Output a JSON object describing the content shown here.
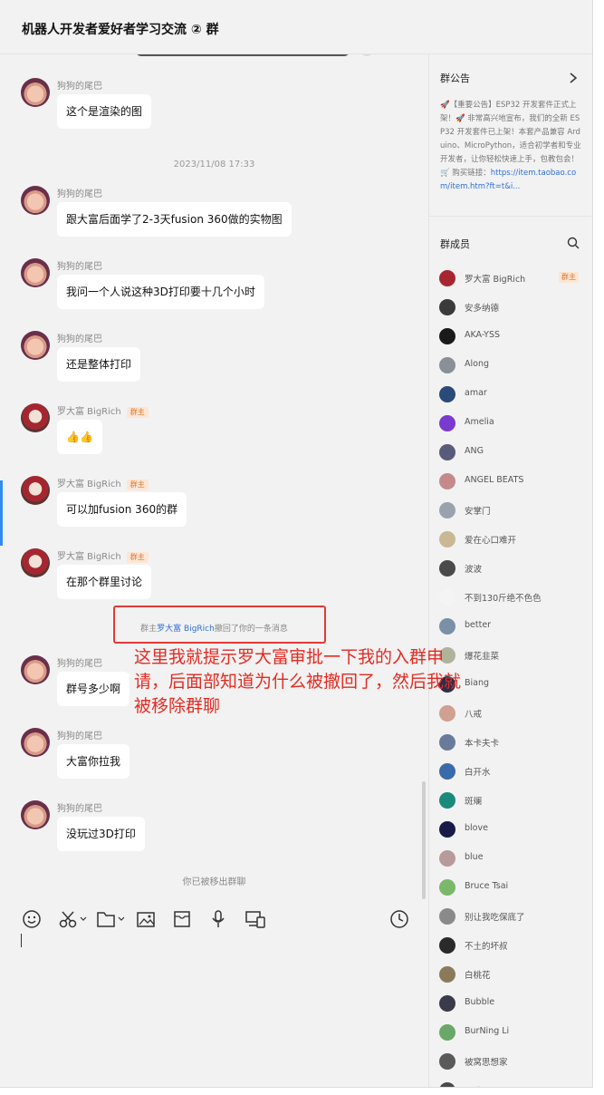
{
  "window": {
    "title": "机器人开发者爱好者学习交流 ② 群"
  },
  "chat": {
    "messages": [
      {
        "sender": "狗狗的尾巴",
        "text": "这个是渲染的图"
      },
      {
        "sender": "狗狗的尾巴",
        "text": "跟大富后面学了2-3天fusion 360做的实物图"
      },
      {
        "sender": "狗狗的尾巴",
        "text": "我问一个人说这种3D打印要十几个小时"
      },
      {
        "sender": "狗狗的尾巴",
        "text": "还是整体打印"
      },
      {
        "sender": "罗大富 BigRich",
        "badge": "群主",
        "text": "👍👍"
      },
      {
        "sender": "罗大富 BigRich",
        "badge": "群主",
        "text": "可以加fusion 360的群"
      },
      {
        "sender": "罗大富 BigRich",
        "badge": "群主",
        "text": "在那个群里讨论"
      },
      {
        "sender": "狗狗的尾巴",
        "text": "群号多少啊"
      },
      {
        "sender": "狗狗的尾巴",
        "text": "大富你拉我"
      },
      {
        "sender": "狗狗的尾巴",
        "text": "没玩过3D打印"
      }
    ],
    "timestamp": "2023/11/08 17:33",
    "recall_note": {
      "prefix": "群主",
      "name": "罗大富 BigRich",
      "suffix": "撤回了你的一条消息"
    },
    "removed_note": "你已被移出群聊",
    "annotation": "这里我就提示罗大富审批一下我的入群申请，后面部知道为什么被撤回了，然后我就被移除群聊"
  },
  "toolbar": {
    "icons": [
      "emoji-icon",
      "scissors-icon",
      "folder-icon",
      "image-icon",
      "inbox-icon",
      "microphone-icon",
      "screen-share-icon",
      "history-clock-icon"
    ]
  },
  "panel": {
    "notice_title": "群公告",
    "notice_text": "🚀【重要公告】ESP32 开发套件正式上架！🚀 非常高兴地宣布，我们的全新 ESP32 开发套件已上架！本套产品兼容 Arduino、MicroPython，适合初学者和专业开发者，让你轻松快速上手，包教包会！🛒 购买链接：",
    "notice_url": "https://item.taobao.com/item.htm?ft=t&i...",
    "members_title": "群成员",
    "members": [
      {
        "name": "罗大富 BigRich",
        "badge": "群主",
        "color": "#a52630"
      },
      {
        "name": "安多纳德",
        "color": "#3a3a3a"
      },
      {
        "name": "AKA-YSS",
        "color": "#1a1a1a"
      },
      {
        "name": "Along",
        "color": "#8a8f98"
      },
      {
        "name": "amar",
        "color": "#2a4a7a"
      },
      {
        "name": "Amelia",
        "color": "#7a3ad0"
      },
      {
        "name": "ANG",
        "color": "#5a5a7a"
      },
      {
        "name": "ANGEL BEATS",
        "color": "#c48a8a"
      },
      {
        "name": "安掌门",
        "color": "#9aa3ad"
      },
      {
        "name": "爱在心口难开",
        "color": "#c9b893"
      },
      {
        "name": "波波",
        "color": "#4a4a4a"
      },
      {
        "name": "不到130斤绝不色色",
        "color": "#f4f4f4"
      },
      {
        "name": "better",
        "color": "#7a8fa8"
      },
      {
        "name": "爆花韭菜",
        "color": "#b0b39a"
      },
      {
        "name": "Biang",
        "color": "#2a2f4a"
      },
      {
        "name": "八戒",
        "color": "#d0a090"
      },
      {
        "name": "本卡夫卡",
        "color": "#6a7a9a"
      },
      {
        "name": "白开水",
        "color": "#3a6aa8"
      },
      {
        "name": "斑斓",
        "color": "#1a8a7a"
      },
      {
        "name": "blove",
        "color": "#1a1a4a"
      },
      {
        "name": "blue",
        "color": "#b89a9a"
      },
      {
        "name": "Bruce Tsai",
        "color": "#7ab86a"
      },
      {
        "name": "别让我吃保底了",
        "color": "#8a8a8a"
      },
      {
        "name": "不土的坏叔",
        "color": "#2a2a2a"
      },
      {
        "name": "白桃花",
        "color": "#8a7a5a"
      },
      {
        "name": "Bubble",
        "color": "#3a3a4a"
      },
      {
        "name": "BurNing Li",
        "color": "#6aa86a"
      },
      {
        "name": "被窝思想家",
        "color": "#5a5a5a"
      },
      {
        "name": "不醉",
        "color": "#4a4a4a"
      }
    ]
  }
}
